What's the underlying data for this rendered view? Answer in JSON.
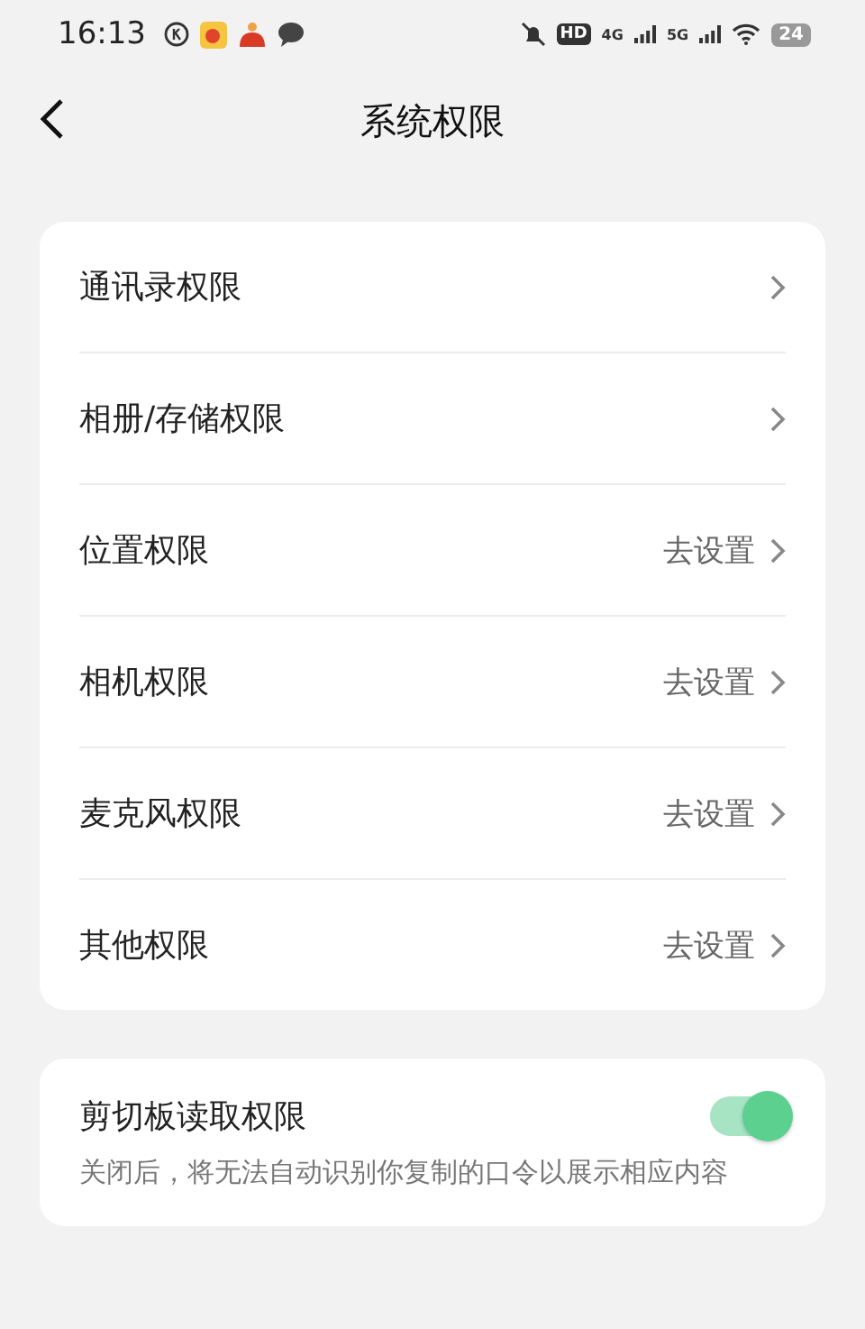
{
  "status_bar": {
    "time": "16:13",
    "hd": "HD",
    "network_1": "4G",
    "network_2": "5G",
    "battery": "24"
  },
  "header": {
    "title": "系统权限"
  },
  "permissions": [
    {
      "label": "通讯录权限"
    },
    {
      "label": "相册/存储权限"
    },
    {
      "label": "位置权限",
      "action": "去设置"
    },
    {
      "label": "相机权限",
      "action": "去设置"
    },
    {
      "label": "麦克风权限",
      "action": "去设置"
    },
    {
      "label": "其他权限",
      "action": "去设置"
    }
  ],
  "clipboard": {
    "label": "剪切板读取权限",
    "on": true,
    "description": "关闭后，将无法自动识别你复制的口令以展示相应内容"
  }
}
